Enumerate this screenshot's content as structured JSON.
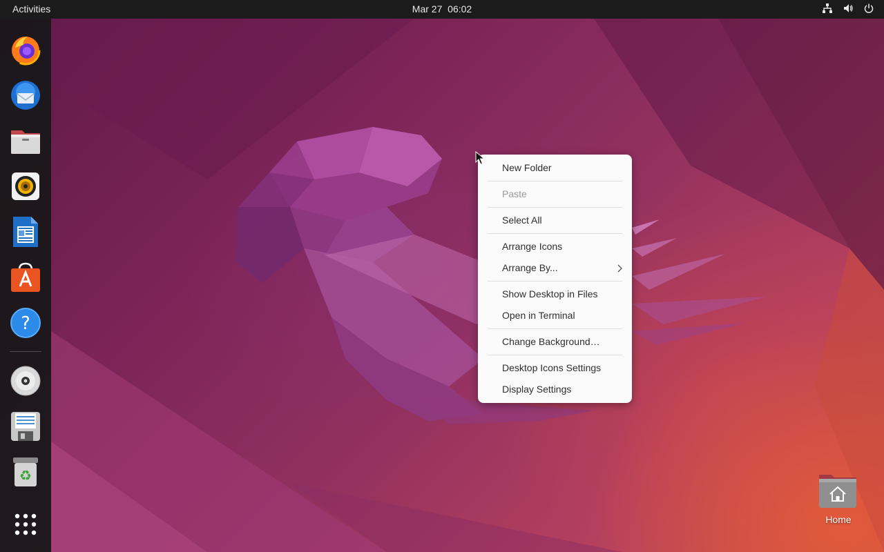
{
  "top_bar": {
    "activities_label": "Activities",
    "date": "Mar 27",
    "time": "06:02",
    "tray_icons": [
      "network-icon",
      "volume-icon",
      "power-icon"
    ]
  },
  "dock": {
    "apps": [
      {
        "name": "firefox-icon"
      },
      {
        "name": "thunderbird-icon"
      },
      {
        "name": "files-icon"
      },
      {
        "name": "rhythmbox-icon"
      },
      {
        "name": "libreoffice-writer-icon"
      },
      {
        "name": "software-center-icon"
      },
      {
        "name": "help-icon"
      },
      {
        "name": "disc-drive-icon"
      },
      {
        "name": "floppy-save-icon"
      },
      {
        "name": "trash-icon"
      },
      {
        "name": "show-applications-icon"
      }
    ]
  },
  "context_menu": {
    "items": [
      {
        "label": "New Folder",
        "enabled": true
      },
      {
        "label": "Paste",
        "enabled": false
      },
      {
        "label": "Select All",
        "enabled": true
      },
      {
        "label": "Arrange Icons",
        "enabled": true
      },
      {
        "label": "Arrange By...",
        "enabled": true,
        "submenu": true
      },
      {
        "label": "Show Desktop in Files",
        "enabled": true
      },
      {
        "label": "Open in Terminal",
        "enabled": true
      },
      {
        "label": "Change Background…",
        "enabled": true
      },
      {
        "label": "Desktop Icons Settings",
        "enabled": true
      },
      {
        "label": "Display Settings",
        "enabled": true
      }
    ]
  },
  "desktop_icons": {
    "home_label": "Home"
  },
  "colors": {
    "top_bar": "#1b1b1b",
    "dock": "#181818",
    "menu_bg": "#fbfbfb",
    "accent_orange": "#e95420"
  }
}
